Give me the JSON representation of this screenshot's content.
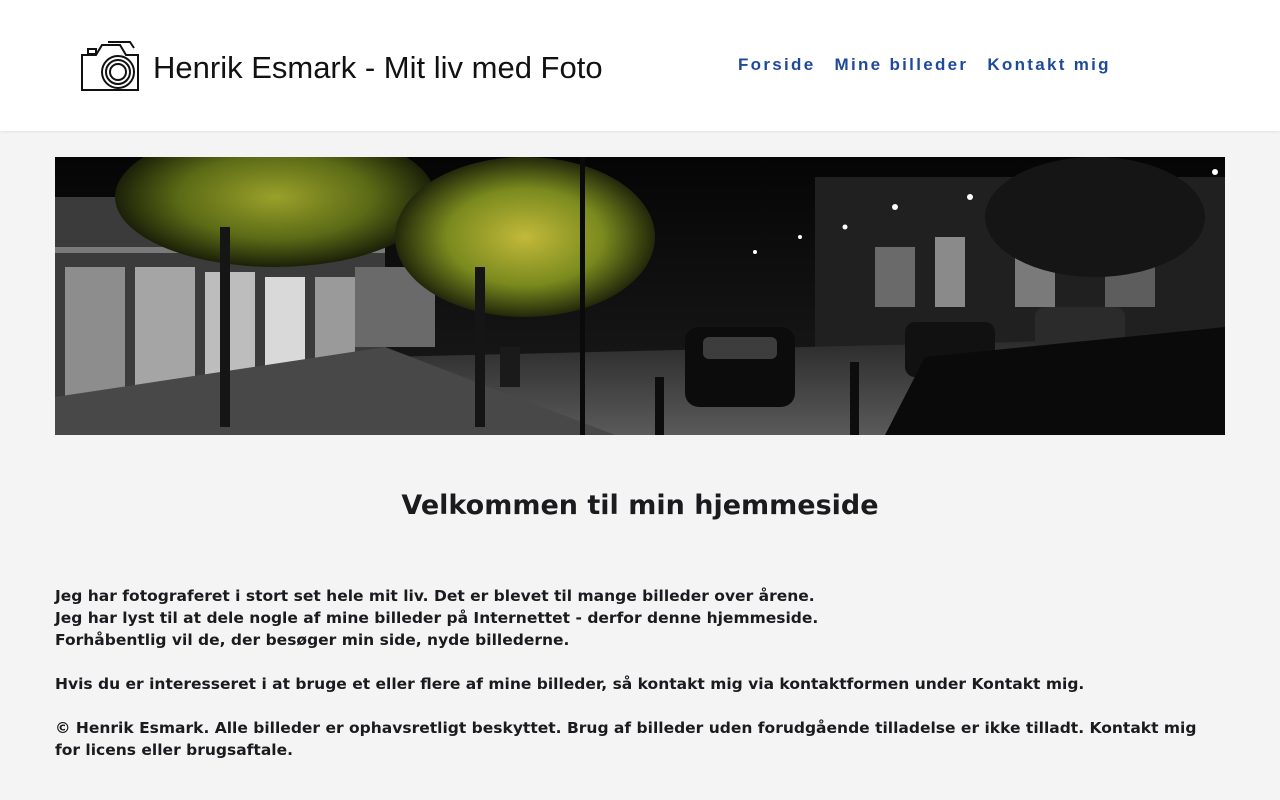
{
  "header": {
    "logo_text": "Henrik Esmark - Mit liv med Foto",
    "logo_icon": "camera-icon"
  },
  "nav": {
    "items": [
      {
        "label": "Forside"
      },
      {
        "label": "Mine billeder"
      },
      {
        "label": "Kontakt mig"
      }
    ],
    "color": "#1f4a9a"
  },
  "hero": {
    "description_icon": "night-street-photo"
  },
  "main": {
    "title": "Velkommen til min hjemmeside",
    "paragraphs": [
      "Jeg har fotograferet i stort set hele mit liv. Det er blevet til mange billeder over årene.",
      "Jeg har lyst til at dele nogle af mine billeder på Internettet - derfor denne hjemmeside.",
      "Forhåbentlig vil de, der besøger min side, nyde billederne.",
      "Hvis du er interesseret i at bruge et eller flere af mine billeder, så kontakt mig via kontaktformen under Kontakt mig.",
      "© Henrik Esmark. Alle billeder er ophavsretligt beskyttet. Brug af billeder uden forudgående tilladelse er ikke tilladt. Kontakt mig for licens eller brugsaftale."
    ]
  },
  "colors": {
    "background": "#f4f4f4",
    "header_bg": "#ffffff",
    "text": "#1b1b1f"
  }
}
